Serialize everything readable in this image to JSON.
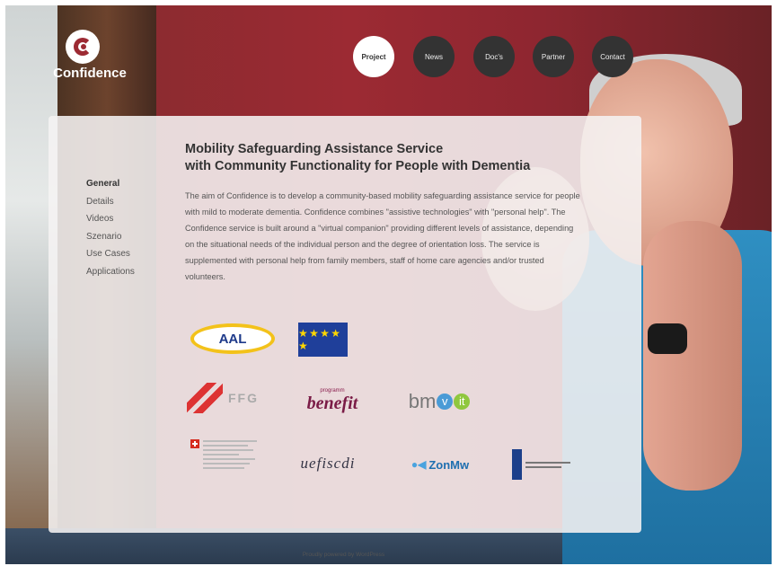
{
  "brand": {
    "name": "Confidence"
  },
  "nav": [
    {
      "label": "Project",
      "active": true
    },
    {
      "label": "News",
      "active": false
    },
    {
      "label": "Doc's",
      "active": false
    },
    {
      "label": "Partner",
      "active": false
    },
    {
      "label": "Contact",
      "active": false
    }
  ],
  "sidebar": [
    {
      "label": "General",
      "active": true
    },
    {
      "label": "Details",
      "active": false
    },
    {
      "label": "Videos",
      "active": false
    },
    {
      "label": "Szenario",
      "active": false
    },
    {
      "label": "Use Cases",
      "active": false
    },
    {
      "label": "Applications",
      "active": false
    }
  ],
  "content": {
    "title_line1": "Mobility Safeguarding Assistance Service",
    "title_line2": "with Community Functionality for People with Dementia",
    "description": "The aim of Confidence is to develop a community-based mobility safeguarding assistance service for people with mild to moderate dementia. Confidence combines \"assistive technologies\" with \"personal help\". The Confidence service is built around a \"virtual companion\" providing different levels of assistance, depending on the situational needs of the individual person and the degree of orientation loss. The service is supplemented with personal help from family members, staff of home care agencies and/or trusted volunteers."
  },
  "partners": {
    "aal": "AAL",
    "eu": "★ ★ ★ ★ ★",
    "ffg": "FFG",
    "benefit_small": "programm",
    "benefit": "benefit",
    "bmvit_prefix": "bm",
    "bmvit_v": "v",
    "bmvit_it": "it",
    "uefiscdi": "uefiscdi",
    "zonmw_dots": "●◀",
    "zonmw": "ZonMw"
  },
  "footer": {
    "text": "Proudly powered by WordPress"
  },
  "colors": {
    "accent": "#9c2a33",
    "nav_dark": "#333333",
    "panel": "#f5f2f3"
  }
}
